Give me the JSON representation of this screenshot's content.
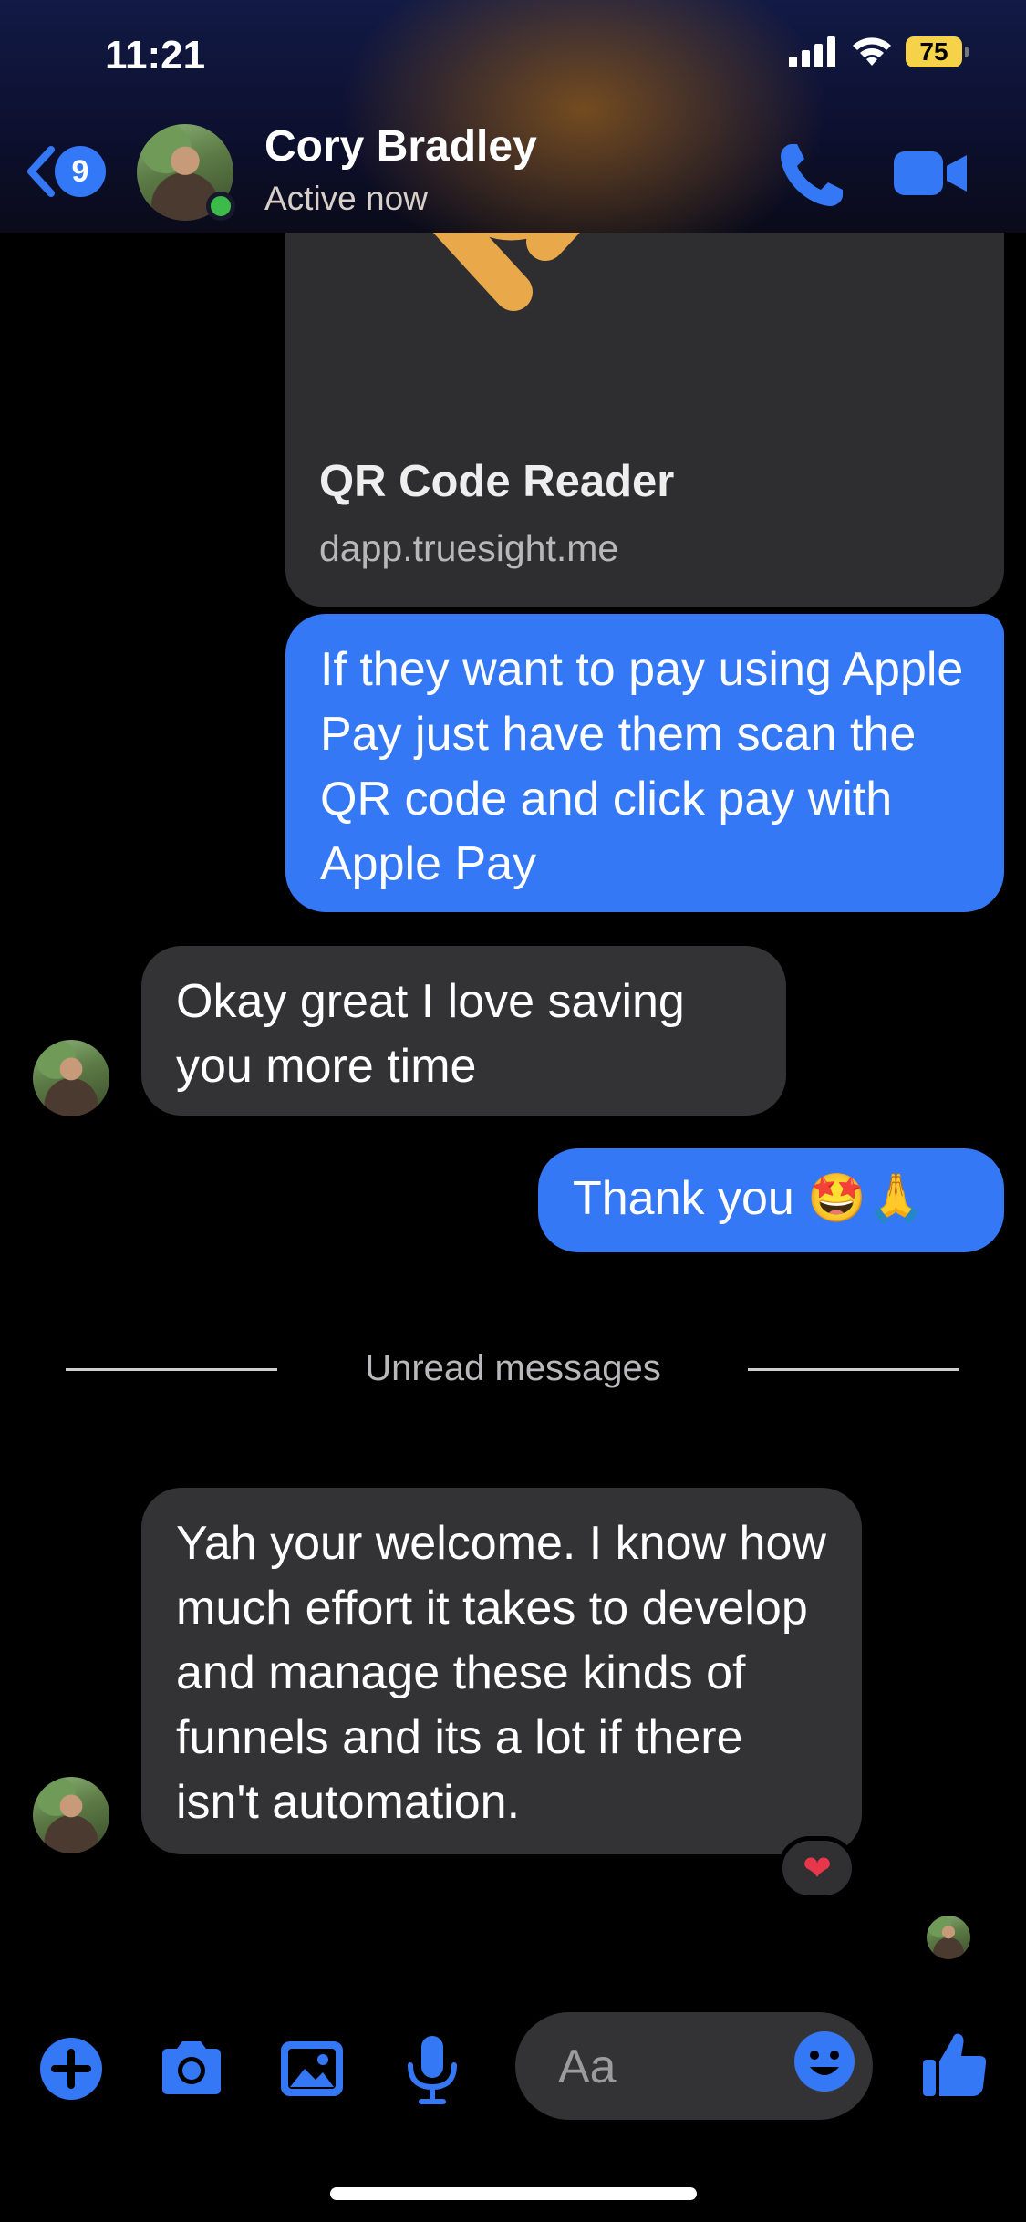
{
  "status_bar": {
    "time": "11:21",
    "battery": "75"
  },
  "header": {
    "back_badge": "9",
    "contact_name": "Cory Bradley",
    "contact_status": "Active now"
  },
  "link_preview": {
    "title": "QR Code Reader",
    "url": "dapp.truesight.me"
  },
  "messages": [
    {
      "direction": "outgoing",
      "text": "If they want to pay using Apple Pay just have them scan the QR code and click pay with Apple Pay"
    },
    {
      "direction": "incoming",
      "text": "Okay great I love saving you more time"
    },
    {
      "direction": "outgoing",
      "text": "Thank you 🤩🙏"
    },
    {
      "direction": "incoming",
      "text": "Yah your welcome. I know how much effort it takes to develop and manage these kinds of funnels and its a lot if there isn't automation.",
      "reaction": "❤"
    }
  ],
  "divider": {
    "label": "Unread messages"
  },
  "composer": {
    "placeholder": "Aa"
  },
  "icons": {
    "toolbar": [
      "plus-icon",
      "camera-icon",
      "gallery-icon",
      "microphone-icon",
      "emoji-icon",
      "thumbs-up-icon"
    ],
    "header": [
      "chevron-left-icon",
      "phone-icon",
      "video-icon"
    ]
  },
  "colors": {
    "accent": "#3478f6",
    "incoming_bubble": "#333335",
    "online": "#3dbb4a",
    "battery": "#f6d24a"
  }
}
